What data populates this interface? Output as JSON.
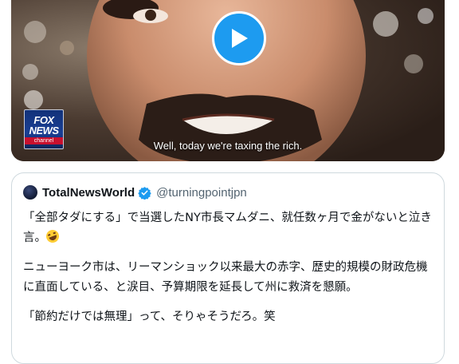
{
  "video": {
    "caption": "Well, today we're taxing the rich.",
    "channel_logo": {
      "line1": "FOX",
      "line2": "NEWS",
      "line3": "channel"
    },
    "play_icon": "play-icon"
  },
  "quoted_tweet": {
    "display_name": "TotalNewsWorld",
    "handle": "@turningpointjpn",
    "verified_icon": "verified-badge-icon",
    "paragraphs": [
      "「全部タダにする」で当選したNY市長マムダニ、就任数ヶ月で金がないと泣き言。",
      "ニューヨーク市は、リーマンショック以来最大の赤字、歴史的規模の財政危機に直面している、と涙目、予算期限を延長して州に救済を懇願。",
      "「節約だけでは無理」って、そりゃそうだろ。笑"
    ],
    "emoji_icon": "rolling-on-floor-laughing-icon"
  },
  "colors": {
    "accent": "#1d9bf0",
    "text": "#0f1419",
    "secondary_text": "#536471",
    "border": "#cfd9de"
  }
}
